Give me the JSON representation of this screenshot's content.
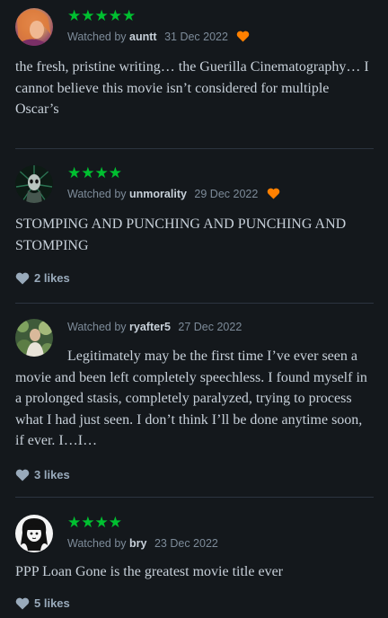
{
  "reviews": [
    {
      "avatar": "avatar-auntt",
      "stars": "★★★★★",
      "watched_prefix": "Watched by",
      "user": "auntt",
      "date": "31 Dec 2022",
      "liked_film": true,
      "text": "the fresh, pristine writing… the Guerilla Cinematography… I cannot believe this movie isn’t considered for multiple Oscar’s",
      "likes": ""
    },
    {
      "avatar": "avatar-unmorality",
      "stars": "★★★★",
      "watched_prefix": "Watched by",
      "user": "unmorality",
      "date": "29 Dec 2022",
      "liked_film": true,
      "text": "STOMPING AND PUNCHING AND PUNCHING AND STOMPING",
      "likes": "2 likes"
    },
    {
      "avatar": "avatar-ryafter5",
      "stars": "",
      "watched_prefix": "Watched by",
      "user": "ryafter5",
      "date": "27 Dec 2022",
      "liked_film": false,
      "text": "Legitimately may be the first time I’ve ever seen a movie and been left completely speechless. I found myself in a prolonged stasis, completely paralyzed, trying to process what I had just seen. I don’t think I’ll be done anytime soon, if ever. I…I…",
      "likes": "3 likes"
    },
    {
      "avatar": "avatar-bry",
      "stars": "★★★★",
      "watched_prefix": "Watched by",
      "user": "bry",
      "date": "23 Dec 2022",
      "liked_film": false,
      "text": "PPP Loan Gone is the greatest movie title ever",
      "likes": "5 likes"
    }
  ],
  "colors": {
    "background": "#14181c",
    "star_green": "#00c030",
    "liked_orange": "#ff8000",
    "muted_text": "#7d8b99",
    "body_text": "#c7d0d9",
    "divider": "#2c3440"
  },
  "icons": {
    "liked": "heart-icon",
    "likes": "heart-icon"
  }
}
